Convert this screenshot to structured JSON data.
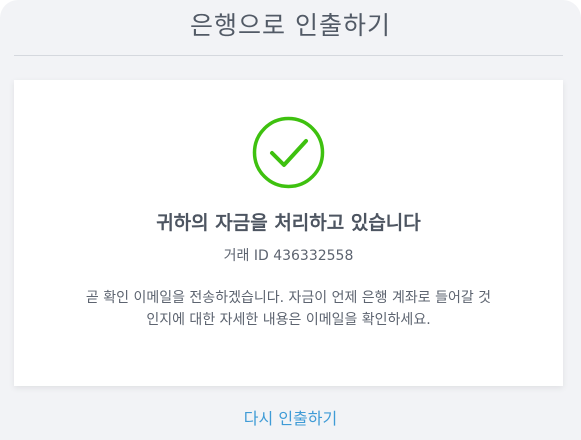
{
  "header": {
    "title": "은행으로 인출하기"
  },
  "status": {
    "icon": "check-circle-icon",
    "icon_color": "#3ec10f",
    "title": "귀하의 자금을 처리하고 있습니다",
    "transaction_id": "거래 ID 436332558",
    "description": "곧 확인 이메일을 전송하겠습니다. 자금이 언제 은행 계좌로 들어갈 것인지에 대한 자세한 내용은 이메일을 확인하세요."
  },
  "footer": {
    "link_label": "다시 인출하기",
    "link_color": "#3f9bd6"
  }
}
